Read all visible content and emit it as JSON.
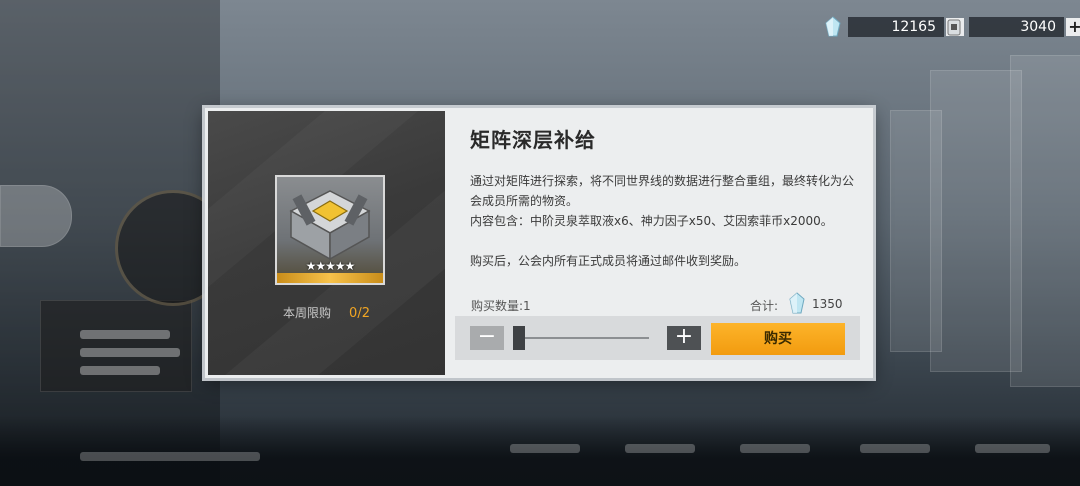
{
  "currency": [
    {
      "icon": "crystal-icon",
      "value": "12165"
    },
    {
      "icon": "token-icon",
      "value": "3040"
    }
  ],
  "dialog": {
    "title": "矩阵深层补给",
    "description": "通过对矩阵进行探索，将不同世界线的数据进行整合重组，最终转化为公会成员所需的物资。\n内容包含：中阶灵泉萃取液x6、神力因子x50、艾因索菲币x2000。\n\n购买后，公会内所有正式成员将通过邮件收到奖励。",
    "item": {
      "stars": "★★★★★",
      "rarity_stars": 5
    },
    "limit_label": "本周限购",
    "limit_value": "0/2",
    "quantity_label": "购买数量:1",
    "total_label": "合计:",
    "total_value": "1350",
    "minus_label": "−",
    "plus_label": "+",
    "buy_label": "购买",
    "slider_fraction": 0
  }
}
